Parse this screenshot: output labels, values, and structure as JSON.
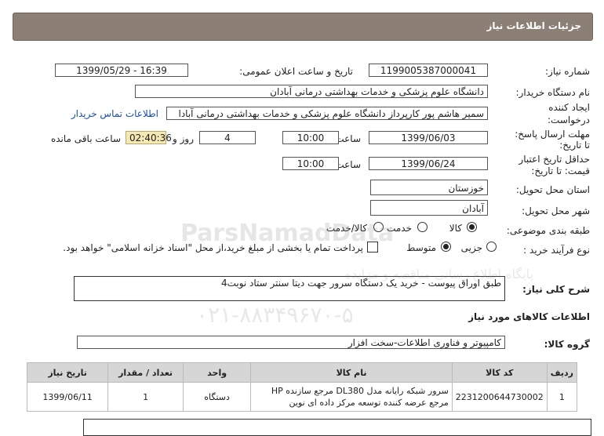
{
  "header": {
    "title": "جزئیات اطلاعات نیاز"
  },
  "fields": {
    "need_number_label": "شماره نیاز:",
    "need_number": "1199005387000041",
    "announce_label": "تاریخ و ساعت اعلان عمومی:",
    "announce_value": "1399/05/29 - 16:39",
    "buyer_label": "نام دستگاه خریدار:",
    "buyer_value": "دانشگاه علوم پزشکی و خدمات بهداشتی درمانی آبادان",
    "creator_label_1": "ایجاد کننده",
    "creator_label_2": "درخواست:",
    "creator_value": "سمیر هاشم پور کارپرداز دانشگاه علوم پزشکی و خدمات بهداشتی درمانی آبادا",
    "contact_link": "اطلاعات تماس خریدار",
    "deadline_label_1": "مهلت ارسال پاسخ:",
    "deadline_label_2": "تا تاریخ:",
    "deadline_date": "1399/06/03",
    "time_label": "ساعت",
    "deadline_time": "10:00",
    "days_value": "4",
    "days_label": "روز و",
    "remaining_time": "02:40:36",
    "remaining_label": "ساعت باقی مانده",
    "validity_label_1": "حداقل تاریخ اعتبار",
    "validity_label_2": "قیمت: تا تاریخ:",
    "validity_date": "1399/06/24",
    "validity_time": "10:00",
    "province_label": "استان محل تحویل:",
    "province_value": "خوزستان",
    "city_label": "شهر محل تحویل:",
    "city_value": "آبادان",
    "category_label": "طبقه بندی موضوعی:",
    "cat_goods": "کالا",
    "cat_service": "خدمت",
    "cat_both": "کالا/خدمت",
    "process_label": "نوع فرآیند خرید :",
    "proc_partial": "جزیی",
    "proc_medium": "متوسط",
    "payment_note": "پرداخت تمام یا بخشی از مبلغ خرید،از محل \"اسناد خزانه اسلامی\" خواهد بود.",
    "description_label": "شرح کلی نیاز:",
    "description_value": "طبق اوراق پیوست - خرید یک دستگاه سرور جهت دیتا سنتر ستاد نوبت4",
    "goods_info_title": "اطلاعات کالاهای مورد نیاز",
    "group_label": "گروه کالا:",
    "group_value": "کامپیوتر و فناوری اطلاعات-سخت افزار"
  },
  "watermark": {
    "line1": "ParsNamadData",
    "line2": "پایگاه اطلاع رسانی مناقصه و مزایده",
    "line3": "۰۲۱-۸۸۳۴۹۶۷۰-۵"
  },
  "table": {
    "headers": [
      "ردیف",
      "کد کالا",
      "نام کالا",
      "واحد",
      "تعداد / مقدار",
      "تاریخ نیاز"
    ],
    "rows": [
      {
        "row": "1",
        "code": "2231200644730002",
        "name": "سرور شبکه رایانه مدل DL380 مرجع سازنده HP مرجع عرضه کننده توسعه مرکز داده ای نوین",
        "unit": "دستگاه",
        "qty": "1",
        "date": "1399/06/11"
      }
    ]
  }
}
